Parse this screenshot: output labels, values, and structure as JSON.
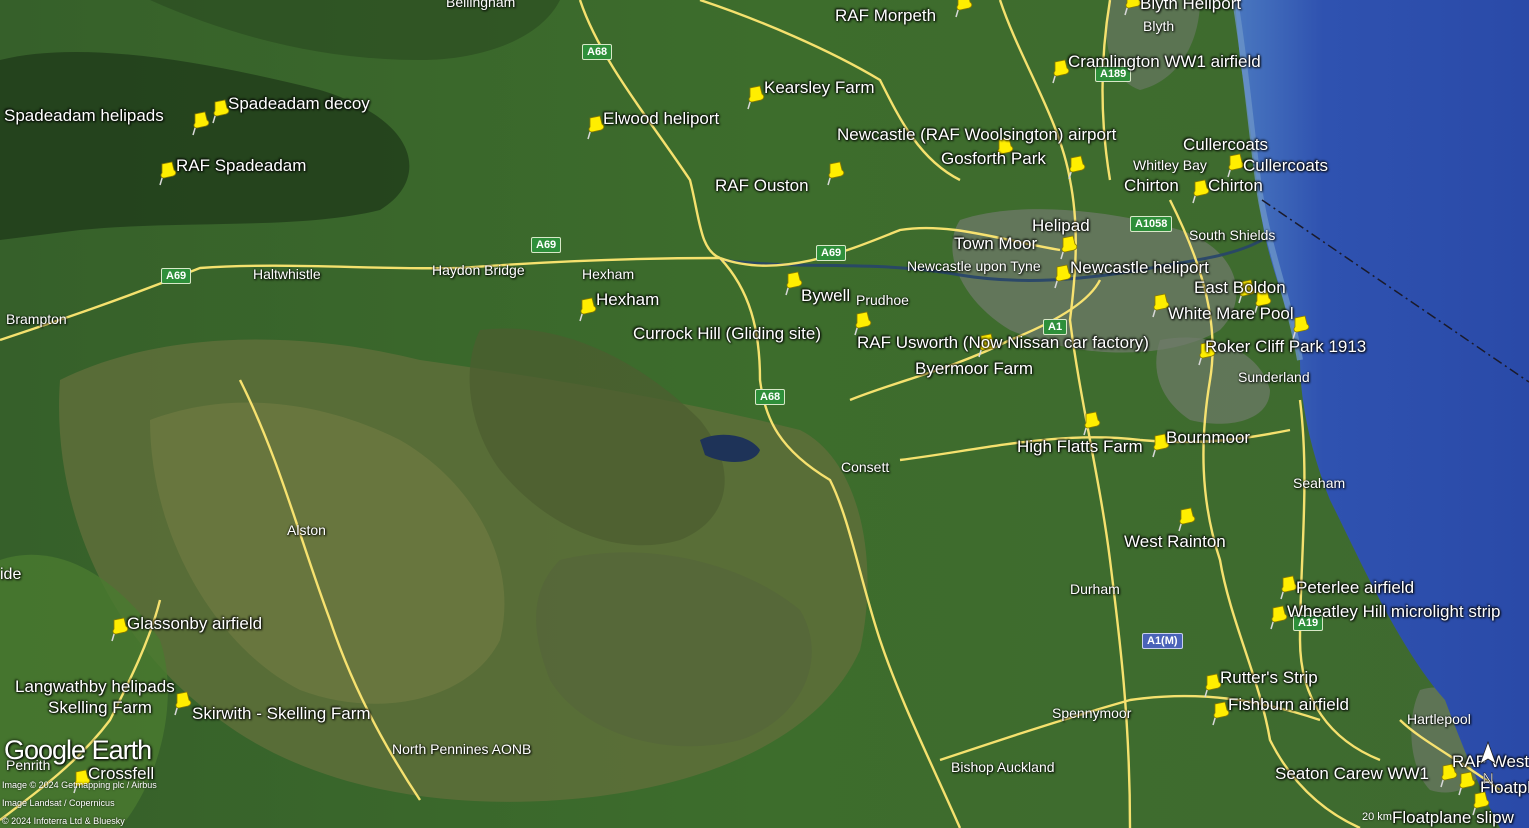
{
  "map": {
    "colors": {
      "sea": "#2f52b0",
      "coast": "#6a93c8",
      "land": "#3a6a2a",
      "moor": "#5e6f3a",
      "road": "#ffe872",
      "urban": "#6f7a6a",
      "pin": "#ffee00"
    },
    "brand": {
      "name": "Google Earth"
    },
    "credits": [
      "Image © 2024 Getmapping plc / Airbus",
      "Image Landsat / Copernicus",
      "© 2024 Infoterra Ltd & Bluesky"
    ],
    "scale_label": "20 km",
    "north_icon": "north-arrow-icon",
    "pin_icon": "yellow-pushpin-icon",
    "pins": [
      {
        "label": "RAF Morpeth"
      },
      {
        "label": "Blyth Heliport"
      },
      {
        "label": "Cramlington WW1 airfield"
      },
      {
        "label": "Kearsley Farm"
      },
      {
        "label": "Spadeadam helipads"
      },
      {
        "label": "Spadeadam decoy"
      },
      {
        "label": "Elwood heliport"
      },
      {
        "label": "Newcastle (RAF Woolsington) airport"
      },
      {
        "label": "Cullercoats"
      },
      {
        "label": "RAF Spadeadam"
      },
      {
        "label": "Gosforth Park"
      },
      {
        "label": "Cullercoats"
      },
      {
        "label": "RAF Ouston"
      },
      {
        "label": "Chirton"
      },
      {
        "label": "Chirton"
      },
      {
        "label": "Helipad"
      },
      {
        "label": "Town Moor"
      },
      {
        "label": "Newcastle heliport"
      },
      {
        "label": "East Boldon"
      },
      {
        "label": "Bywell"
      },
      {
        "label": "Hexham"
      },
      {
        "label": "White Mare Pool"
      },
      {
        "label": "Currock Hill (Gliding site)"
      },
      {
        "label": "RAF Usworth (Now Nissan car factory)"
      },
      {
        "label": "Roker Cliff Park 1913"
      },
      {
        "label": "Byermoor Farm"
      },
      {
        "label": "High Flatts Farm"
      },
      {
        "label": "Bournmoor"
      },
      {
        "label": "West Rainton"
      },
      {
        "label": "Peterlee airfield"
      },
      {
        "label": "Wheatley Hill microlight strip"
      },
      {
        "label": "Glassonby airfield"
      },
      {
        "label": "Rutter's Strip"
      },
      {
        "label": "Langwathby helipads"
      },
      {
        "label": "Skelling Farm"
      },
      {
        "label": "Skirwith - Skelling Farm"
      },
      {
        "label": "Fishburn airfield"
      },
      {
        "label": "Crossfell"
      },
      {
        "label": "Seaton Carew WW1"
      },
      {
        "label": "RAF West"
      },
      {
        "label": "Floatplane slipway"
      },
      {
        "label": "Floatplane slipw"
      }
    ],
    "places": [
      {
        "name": "Bellingham"
      },
      {
        "name": "Blyth"
      },
      {
        "name": "Whitley Bay"
      },
      {
        "name": "South Shields"
      },
      {
        "name": "Newcastle upon Tyne"
      },
      {
        "name": "Haltwhistle"
      },
      {
        "name": "Haydon Bridge"
      },
      {
        "name": "Hexham"
      },
      {
        "name": "Brampton"
      },
      {
        "name": "Prudhoe"
      },
      {
        "name": "Sunderland"
      },
      {
        "name": "Consett"
      },
      {
        "name": "Seaham"
      },
      {
        "name": "Alston"
      },
      {
        "name": "Durham"
      },
      {
        "name": "Spennymoor"
      },
      {
        "name": "Hartlepool"
      },
      {
        "name": "Penrith"
      },
      {
        "name": "Bishop Auckland"
      },
      {
        "name": "North Pennines AONB"
      },
      {
        "name": "ide"
      }
    ],
    "roads": [
      {
        "ref": "A68"
      },
      {
        "ref": "A189"
      },
      {
        "ref": "A69"
      },
      {
        "ref": "A69"
      },
      {
        "ref": "A69"
      },
      {
        "ref": "A1058"
      },
      {
        "ref": "A1"
      },
      {
        "ref": "A68"
      },
      {
        "ref": "A1(M)"
      },
      {
        "ref": "A19"
      }
    ]
  }
}
